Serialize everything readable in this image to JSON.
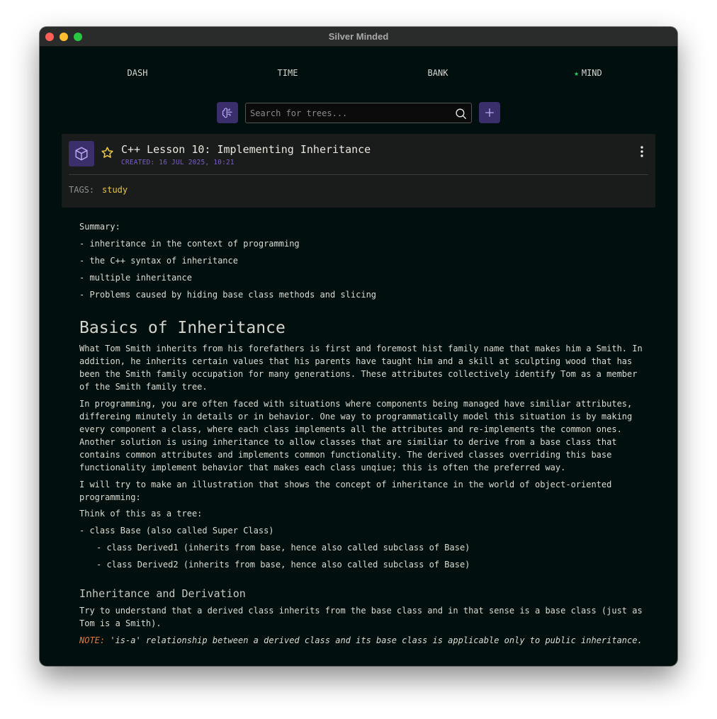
{
  "window": {
    "title": "Silver Minded"
  },
  "nav": {
    "items": [
      {
        "label": "DASH",
        "active": false
      },
      {
        "label": "TIME",
        "active": false
      },
      {
        "label": "BANK",
        "active": false
      },
      {
        "label": "MIND",
        "active": true,
        "marker": "★"
      }
    ]
  },
  "toolbar": {
    "brain_icon": "brain-icon",
    "search_placeholder": "Search for trees...",
    "search_value": "",
    "add_icon": "plus-icon"
  },
  "note": {
    "title": "C++ Lesson 10: Implementing Inheritance",
    "created": "CREATED: 16 JUL 2025, 10:21",
    "tags_label": "TAGS:",
    "tags": [
      "study"
    ]
  },
  "body": {
    "summary_heading": "Summary:",
    "summary_items": [
      "- inheritance in the context of programming",
      "- the C++ syntax of inheritance",
      "- multiple inheritance",
      "- Problems caused by hiding base class methods and slicing"
    ],
    "section1": {
      "heading": "Basics of Inheritance",
      "paragraphs": [
        "What Tom Smith inherits from his forefathers is first and foremost hist family name that makes him a Smith. In addition, he inherits certain values that his parents have taught him and a skill at sculpting wood that has been the Smith family occupation for many generations. These attributes collectively identify Tom as a member of the Smith family tree.",
        "In programming, you are often faced with situations where components being managed have similiar attributes, differeing minutely in details or in behavior. One way to programmatically model this situation is by making every component a class, where each class implements all the attributes and re-implements the common ones. Another solution is using inheritance to allow classes that are similiar to derive from a base class that contains common attributes and implements common functionality. The derived classes overriding this base functionality implement behavior that makes each class unqiue; this is often the preferred way.",
        "I will try to make an illustration that shows the concept of inheritance in the world of object-oriented programming:",
        "Think of this as a tree:"
      ],
      "tree": [
        {
          "text": "- class Base (also called Super Class)",
          "level": 0
        },
        {
          "text": "- class Derived1 (inherits from base, hence also called subclass of Base)",
          "level": 1
        },
        {
          "text": "- class Derived2 (inherits from base, hence also called subclass of Base)",
          "level": 1
        }
      ]
    },
    "section2": {
      "heading": "Inheritance and Derivation",
      "paragraph": "Try to understand that a derived class inherits from the base class and in that sense is a base class (just as Tom is a Smith).",
      "note_label": "NOTE:",
      "note_text": " 'is-a' relationship between a derived class and its base class is applicable only to public inheritance."
    }
  },
  "colors": {
    "background": "#020f0f",
    "accent_purple": "#3a2f6b",
    "tag_yellow": "#e8c547",
    "note_orange": "#e07a3c",
    "active_green": "#2ecc71"
  }
}
